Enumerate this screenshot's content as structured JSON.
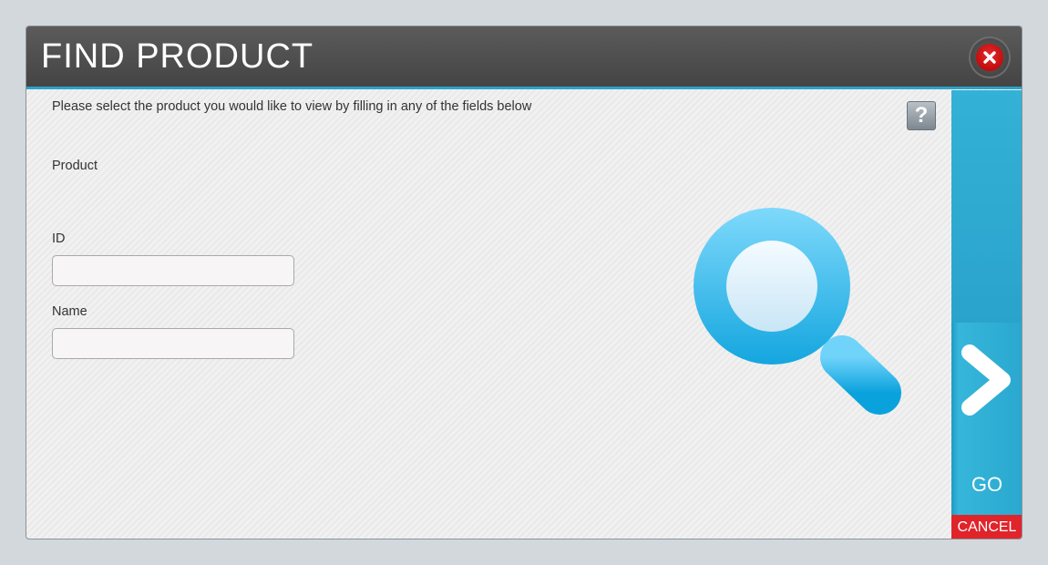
{
  "dialog": {
    "title": "FIND PRODUCT",
    "instructions": "Please select the product you would like to view by filling in any of the fields below",
    "help_label": "?",
    "go_label": "GO",
    "cancel_label": "CANCEL"
  },
  "form": {
    "product_label": "Product",
    "id_label": "ID",
    "id_value": "",
    "name_label": "Name",
    "name_value": ""
  },
  "icons": {
    "close": "close-icon",
    "help": "help-icon",
    "magnifier": "magnifier-icon",
    "go_arrow": "chevron-right-icon"
  },
  "colors": {
    "titlebar": "#4f4f4f",
    "accent": "#2aa8d0",
    "cancel": "#e0242a",
    "close": "#c40000"
  }
}
